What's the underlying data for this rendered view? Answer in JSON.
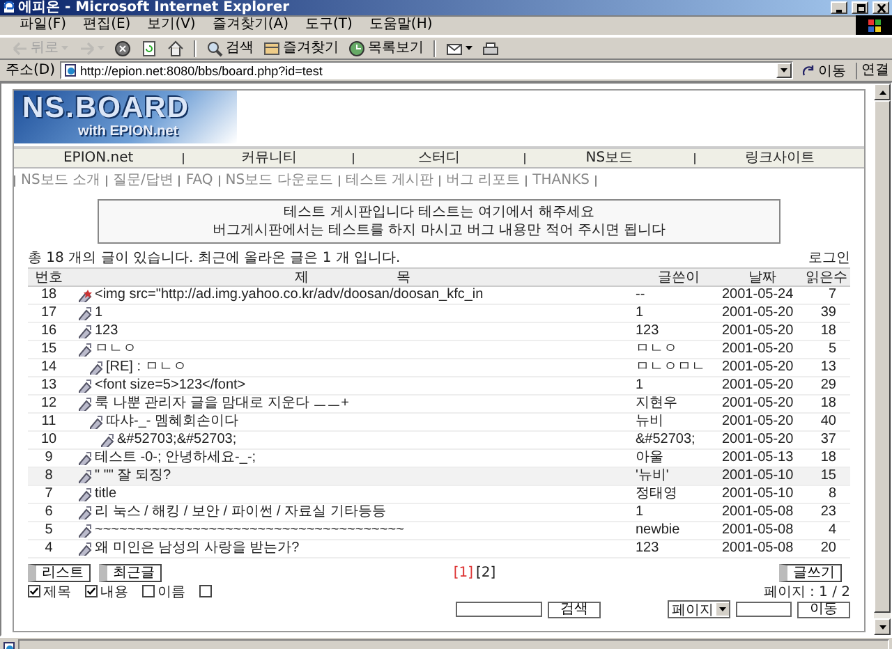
{
  "window": {
    "title": "에피온 - Microsoft Internet Explorer"
  },
  "menu": [
    "파일(F)",
    "편집(E)",
    "보기(V)",
    "즐겨찾기(A)",
    "도구(T)",
    "도움말(H)"
  ],
  "toolbar": [
    {
      "kind": "back",
      "label": "뒤로",
      "disabled": true
    },
    {
      "kind": "forward",
      "disabled": true
    },
    {
      "kind": "stop",
      "disabled": false
    },
    {
      "kind": "refresh",
      "disabled": false
    },
    {
      "kind": "home",
      "disabled": false
    },
    {
      "kind": "search",
      "label": "검색",
      "disabled": false
    },
    {
      "kind": "favorites",
      "label": "즐겨찾기",
      "disabled": false
    },
    {
      "kind": "history",
      "label": "목록보기",
      "disabled": false
    },
    {
      "kind": "mail",
      "disabled": false
    },
    {
      "kind": "print",
      "disabled": false
    }
  ],
  "address": {
    "label": "주소(D)",
    "url": "http://epion.net:8080/bbs/board.php?id=test",
    "go": "이동",
    "links": "연결"
  },
  "board": {
    "logo": {
      "title": "NS.BOARD",
      "subtitle": "with EPION.net"
    },
    "nav": [
      "EPION.net",
      "커뮤니티",
      "스터디",
      "NS보드",
      "링크사이트"
    ],
    "sublinks": [
      "NS보드 소개",
      "질문/답변",
      "FAQ",
      "NS보드 다운로드",
      "테스트 게시판",
      "버그 리포트",
      "THANKS"
    ],
    "notice": [
      "테스트 게시판입니다 테스트는 여기에서 해주세요",
      "버그게시판에서는 테스트를 하지 마시고 버그 내용만 적어 주시면 됩니다"
    ],
    "summary": "총 18 개의 글이 있습니다. 최근에 올라온 글은 1 개 입니다.",
    "login": "로그인",
    "columns": [
      "번호",
      "제 목",
      "글쓴이",
      "날짜",
      "읽은수"
    ],
    "rows": [
      {
        "number": "18",
        "subject": "<img src=\"http://ad.img.yahoo.co.kr/adv/doosan/doosan_kfc_in",
        "author": "--",
        "date": "2001-05-24",
        "reads": "7",
        "new": true,
        "selected": false
      },
      {
        "number": "17",
        "subject": "1",
        "author": "1",
        "date": "2001-05-20",
        "reads": "39",
        "new": false,
        "selected": false
      },
      {
        "number": "16",
        "subject": "123",
        "author": "123",
        "date": "2001-05-20",
        "reads": "18",
        "new": false,
        "selected": false
      },
      {
        "number": "15",
        "subject": "ㅁㄴㅇ",
        "author": "ㅁㄴㅇ",
        "date": "2001-05-20",
        "reads": "5",
        "new": false,
        "selected": false,
        "children": [
          {
            "number": "14",
            "subject": "[RE] : ㅁㄴㅇ",
            "author": "ㅁㄴㅇㅁㄴ",
            "date": "2001-05-20",
            "reads": "13",
            "new": false,
            "selected": false
          }
        ]
      },
      {
        "number": "13",
        "subject": "<font size=5>123</font>",
        "author": "1",
        "date": "2001-05-20",
        "reads": "29",
        "new": false,
        "selected": false
      },
      {
        "number": "12",
        "subject": "룩 나뿐 관리자 글을 맘대로 지운다 ㅡㅡ+",
        "author": "지현우",
        "date": "2001-05-20",
        "reads": "18",
        "new": false,
        "selected": false,
        "children": [
          {
            "number": "11",
            "subject": "따샤-_- 멤혜회손이다",
            "author": "뉴비",
            "date": "2001-05-20",
            "reads": "40",
            "new": false,
            "selected": false,
            "children": [
              {
                "number": "10",
                "subject": "&#52703;&#52703;",
                "author": "&#52703;",
                "date": "2001-05-20",
                "reads": "37",
                "new": false,
                "selected": false
              }
            ]
          }
        ]
      },
      {
        "number": "9",
        "subject": "테스트 -0-; 안녕하세요-_-;",
        "author": "아울",
        "date": "2001-05-13",
        "reads": "18",
        "new": false,
        "selected": false
      },
      {
        "number": "8",
        "subject": "\" \"\" 잘 되징?",
        "author": "'뉴비'",
        "date": "2001-05-10",
        "reads": "15",
        "new": false,
        "selected": true
      },
      {
        "number": "7",
        "subject": "title",
        "author": "정태영",
        "date": "2001-05-10",
        "reads": "8",
        "new": false,
        "selected": false
      },
      {
        "number": "6",
        "subject": "리 눅스 / 해킹 / 보안 / 파이썬 / 자료실 기타등등",
        "author": "1",
        "date": "2001-05-08",
        "reads": "23",
        "new": false,
        "selected": false
      },
      {
        "number": "5",
        "subject": "~~~~~~~~~~~~~~~~~~~~~~~~~~~~~~~~~~~~~~",
        "author": "newbie",
        "date": "2001-05-08",
        "reads": "4",
        "new": false,
        "selected": false
      },
      {
        "number": "4",
        "subject": "왜 미인은 남성의 사랑을 받는가?",
        "author": "123",
        "date": "2001-05-08",
        "reads": "20",
        "new": false,
        "selected": false
      }
    ],
    "buttons": [
      "리스트",
      "최근글"
    ],
    "pages": [
      {
        "label": "[1]",
        "selected": true
      },
      {
        "label": "[2]",
        "selected": false
      }
    ],
    "write": "글쓰기",
    "search_options": [
      {
        "label": "제목",
        "checked": true
      },
      {
        "label": "내용",
        "checked": true
      },
      {
        "label": "이름",
        "checked": false
      },
      {
        "checked": false
      }
    ],
    "search_button": "검색",
    "page_info": "페이지 : 1 / 2",
    "page_select": "페이지",
    "page_go": "이동"
  }
}
